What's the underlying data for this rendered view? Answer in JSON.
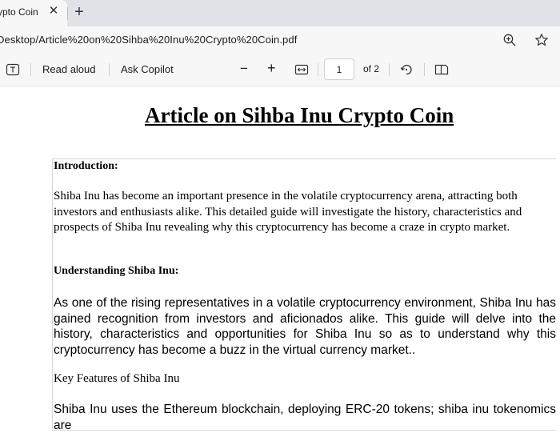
{
  "browser": {
    "tab_title": "ypto Coin",
    "tab_close": "✕",
    "new_tab": "+",
    "url": "Desktop/Article%20on%20Sihba%20Inu%20Crypto%20Coin.pdf"
  },
  "toolbar": {
    "read_aloud": "Read aloud",
    "ask_copilot": "Ask Copilot",
    "zoom_out": "−",
    "zoom_in": "+",
    "page_number": "1",
    "page_total": "of 2"
  },
  "document": {
    "title": "Article on Sihba Inu Crypto Coin",
    "intro_heading": "Introduction:",
    "intro_paragraph": "Shiba Inu has become an important presence in the volatile cryptocurrency arena, attracting both investors and enthusiasts alike. This detailed guide will investigate the history, characteristics and prospects of Shiba Inu revealing why this cryptocurrency has become a craze in crypto market.",
    "understanding_heading": "Understanding Shiba Inu:",
    "understanding_paragraph": "As one of the rising representatives in a volatile cryptocurrency environment, Shiba Inu has gained recognition from investors and aficionados alike. This guide will delve into the history, characteristics and opportunities for Shiba Inu so as to understand why this cryptocurrency has become a buzz in the virtual currency market..",
    "features_heading": "Key Features of Shiba Inu",
    "features_paragraph": "Shiba Inu uses the Ethereum blockchain, deploying ERC-20 tokens; shiba inu tokenomics are"
  }
}
